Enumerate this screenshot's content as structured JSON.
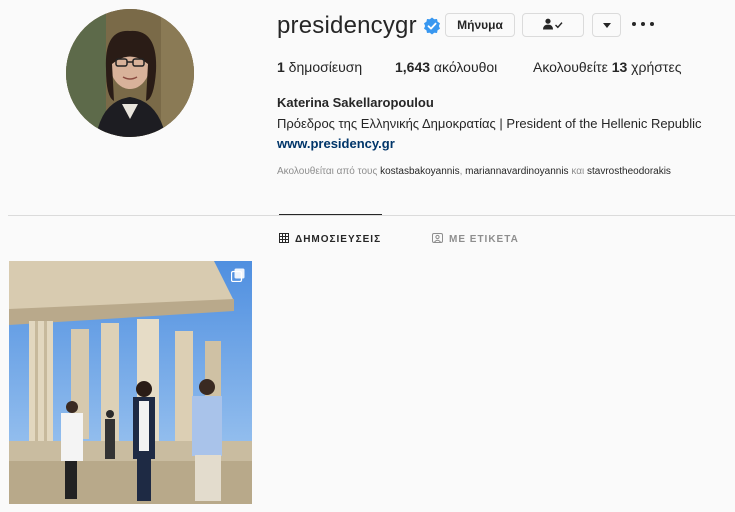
{
  "profile": {
    "username": "presidencygr",
    "full_name": "Katerina Sakellaropoulou",
    "bio": "Πρόεδρος της Ελληνικής Δημοκρατίας | President of the Hellenic Republic",
    "website": "www.presidency.gr",
    "verified_icon": "verified-badge-icon"
  },
  "actions": {
    "message_label": "Μήνυμα",
    "follow_icon": "person-check-icon",
    "dropdown_icon": "caret-down-icon",
    "more_icon": "ellipsis-icon"
  },
  "stats": {
    "posts_count": "1",
    "posts_label": " δημοσίευση",
    "followers_count": "1,643",
    "followers_label": " ακόλουθοι",
    "following_prefix": "Ακολουθείτε ",
    "following_count": "13",
    "following_suffix": " χρήστες"
  },
  "followed_by": {
    "prefix": "Ακολουθείται από τους ",
    "accounts": [
      "kostasbakoyannis",
      "mariannavardinoyannis",
      "stavrostheodorakis"
    ],
    "separator": ", ",
    "conjunction": " και "
  },
  "tabs": [
    {
      "label": "ΔΗΜΟΣΙΕΥΣΕΙΣ",
      "icon": "grid-icon",
      "active": true
    },
    {
      "label": "ΜΕ ΕΤΙΚΕΤΑ",
      "icon": "tagged-person-icon",
      "active": false
    }
  ],
  "posts": [
    {
      "multiple": true,
      "icon": "carousel-icon"
    }
  ],
  "colors": {
    "verified_blue": "#3897f0",
    "link": "#003569",
    "muted": "#8e8e8e",
    "border": "#dbdbdb"
  }
}
